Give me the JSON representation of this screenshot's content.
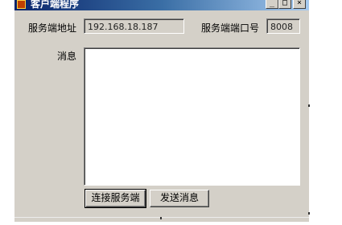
{
  "window": {
    "title": "客户端程序",
    "minimize_glyph": "_",
    "maximize_glyph": "□",
    "close_glyph": "×"
  },
  "form": {
    "server_address_label": "服务端地址",
    "server_address_value": "192.168.18.187",
    "server_port_label": "服务端端口号",
    "server_port_value": "8008",
    "message_label": "消息",
    "message_value": ""
  },
  "buttons": {
    "connect_label": "连接服务端",
    "send_label": "发送消息"
  },
  "colors": {
    "window_face": "#d4d0c8",
    "titlebar_start": "#0a246a",
    "titlebar_end": "#a6caf0"
  }
}
